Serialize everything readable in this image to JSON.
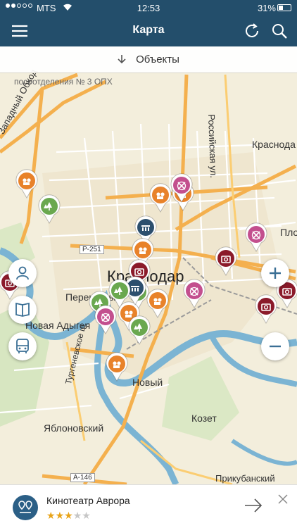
{
  "status": {
    "carrier": "MTS",
    "time": "12:53",
    "battery": "31%",
    "battery_level": 0.31
  },
  "header": {
    "title": "Карта"
  },
  "filter": {
    "label": "Объекты"
  },
  "map": {
    "labels": {
      "city": "Краснодар",
      "perekatny": "Перекатный",
      "novaya": "Новая Адыгея",
      "novy": "Новый",
      "yablonovsky": "Яблоновский",
      "kozet": "Козет",
      "krasnodar_east": "Краснода",
      "rossiyskaya": "Российская ул.",
      "zapadny": "Западный Обход",
      "turgenevskoe": "Тургеневское ш.",
      "p251": "Р-251",
      "a146": "А-146",
      "plo": "Пло",
      "posoch": "посоотделения № 3 ОПХ",
      "prikubansky": "Прикубанский",
      "yablo_short": "Яблоновский"
    }
  },
  "colors": {
    "header": "#234e6b",
    "cinema": "#e8822a",
    "park": "#6aa84f",
    "museum": "#8b1a2a",
    "theater": "#c34f8e",
    "library": "#2c4f6e"
  },
  "card": {
    "name": "Кинотеатр Аврора",
    "rating": 3,
    "rating_max": 5
  }
}
